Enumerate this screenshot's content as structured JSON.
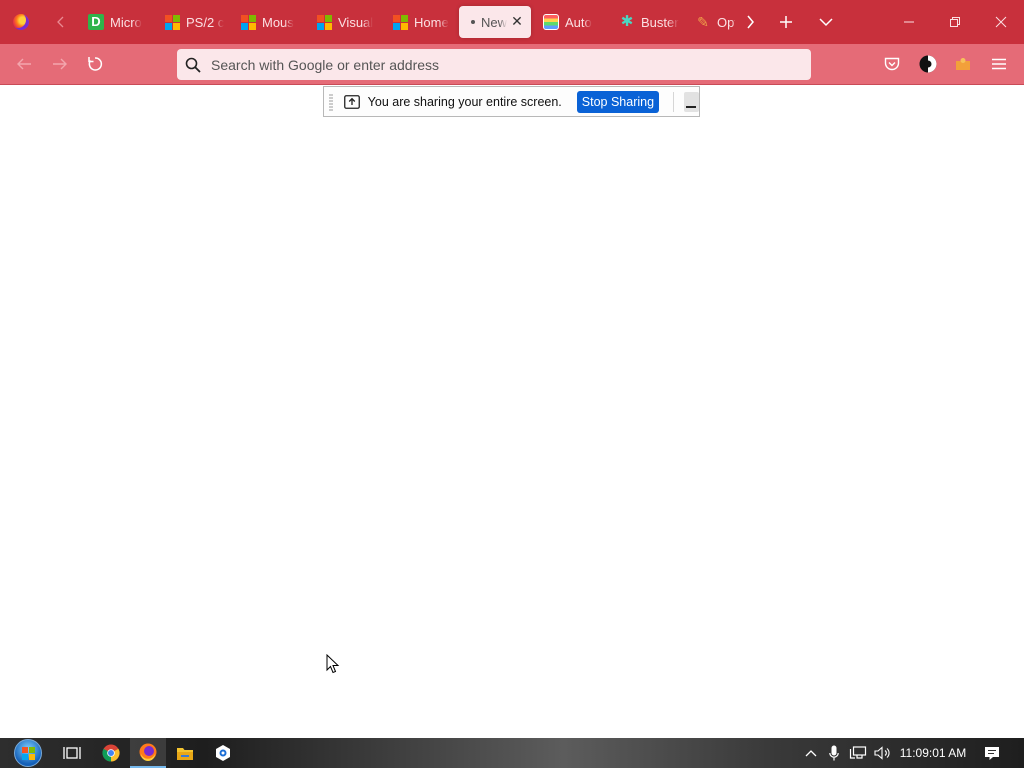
{
  "browser": {
    "tabs": [
      {
        "title": "Micro",
        "favicon": "d-app-icon"
      },
      {
        "title": "PS/2 c",
        "favicon": "microsoft-icon"
      },
      {
        "title": "Mous",
        "favicon": "microsoft-icon"
      },
      {
        "title": "Visual",
        "favicon": "microsoft-icon"
      },
      {
        "title": "Home",
        "favicon": "microsoft-icon"
      },
      {
        "title": "New",
        "favicon": "dot",
        "active": true
      },
      {
        "title": "Auto",
        "favicon": "rainbow-icon"
      },
      {
        "title": "Buster",
        "favicon": "buster-icon"
      },
      {
        "title": "Opt",
        "favicon": "options-icon"
      }
    ],
    "urlbar": {
      "placeholder": "Search with Google or enter address"
    }
  },
  "sharing_bar": {
    "message": "You are sharing your entire screen.",
    "stop_label": "Stop Sharing"
  },
  "taskbar": {
    "clock": "11:09:01 AM"
  },
  "colors": {
    "tabstrip": "#c8303c",
    "navbar": "#e56b77",
    "stop_button": "#0a62d6"
  }
}
